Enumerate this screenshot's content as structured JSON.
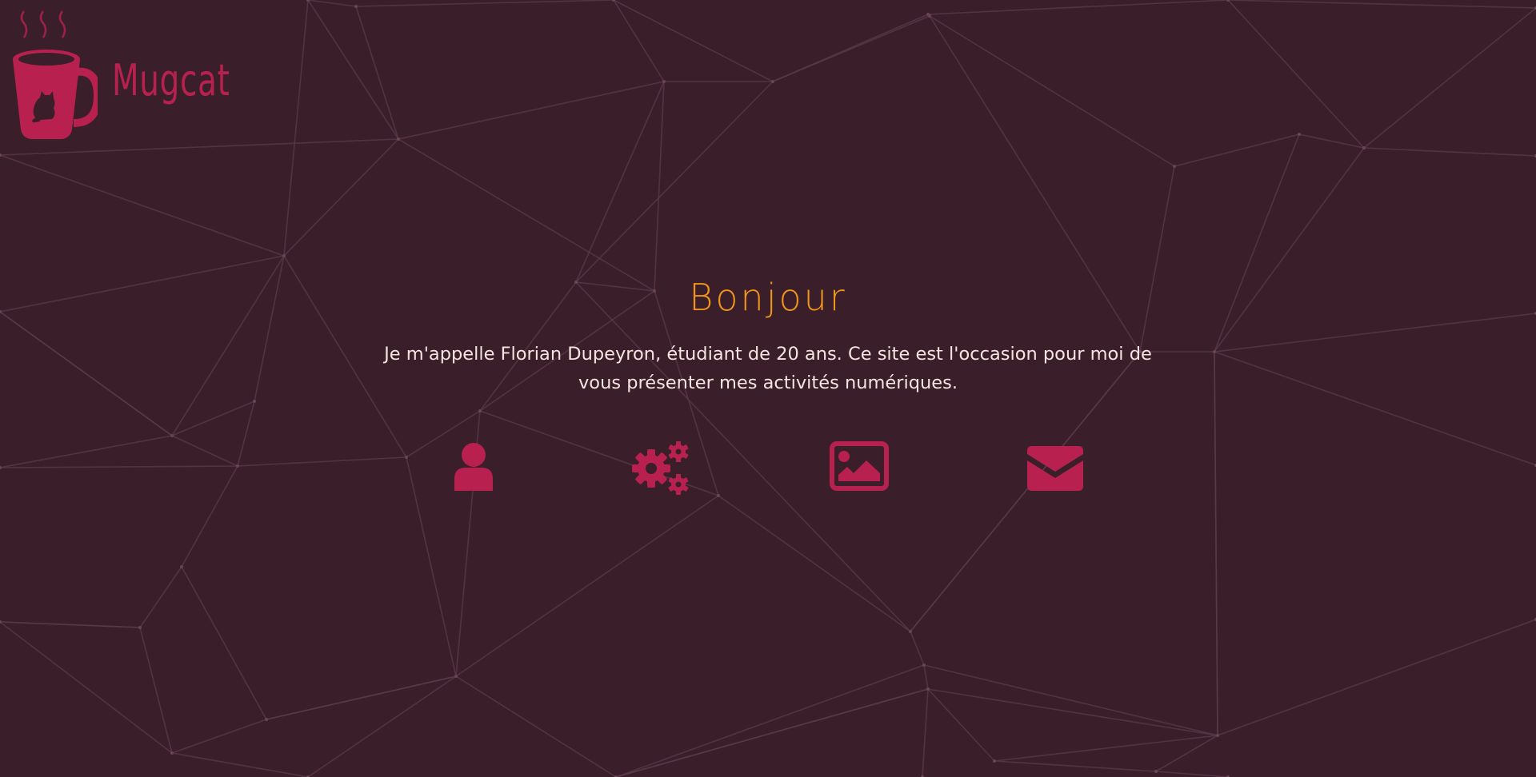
{
  "logo": {
    "text": "Mugcat",
    "icon": "mug-cat-icon",
    "color": "#b8214f"
  },
  "hero": {
    "title": "Bonjour",
    "text": "Je m'appelle Florian Dupeyron, étudiant de 20 ans. Ce site est l'occasion pour moi de vous présenter mes activités numériques."
  },
  "nav_icons": [
    {
      "icon": "user-icon"
    },
    {
      "icon": "gears-icon"
    },
    {
      "icon": "image-icon"
    },
    {
      "icon": "envelope-icon"
    }
  ],
  "colors": {
    "background": "#3a1f2b",
    "mesh_lines": "#5c3a4a",
    "accent": "#b8214f",
    "title": "#f0951a",
    "text": "#f5e4e0"
  }
}
